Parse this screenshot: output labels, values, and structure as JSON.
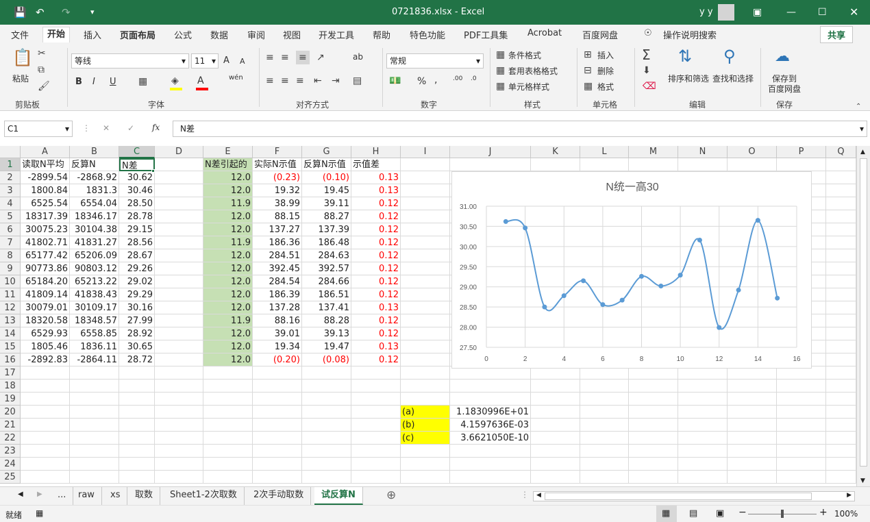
{
  "window": {
    "title": "0721836.xlsx  -  Excel",
    "user": "y y"
  },
  "menu": [
    "文件",
    "开始",
    "插入",
    "页面布局",
    "公式",
    "数据",
    "审阅",
    "视图",
    "开发工具",
    "帮助",
    "特色功能",
    "PDF工具集",
    "Acrobat",
    "百度网盘"
  ],
  "menu_active": "开始",
  "tell_me": "操作说明搜索",
  "share": "共享",
  "ribbon": {
    "clipboard": {
      "label": "剪贴板",
      "paste": "粘贴"
    },
    "font": {
      "label": "字体",
      "name": "等线",
      "size": "11",
      "bold": "B",
      "italic": "I",
      "underline": "U",
      "grow": "A",
      "shrink": "A",
      "phonetic": "wén"
    },
    "alignment": {
      "label": "对齐方式",
      "wrap": "ab"
    },
    "number": {
      "label": "数字",
      "format": "常规",
      "percent": "%",
      "comma": ","
    },
    "styles": {
      "label": "样式",
      "conditional": "条件格式",
      "table": "套用表格格式",
      "cell": "单元格样式"
    },
    "cells": {
      "label": "单元格",
      "insert": "插入",
      "delete": "删除",
      "format": "格式"
    },
    "editing": {
      "label": "编辑",
      "sort": "排序和筛选",
      "find": "查找和选择"
    },
    "save": {
      "label": "保存",
      "btn1": "保存到",
      "btn2": "百度网盘"
    }
  },
  "namebox": "C1",
  "formula": "N差",
  "fx": "fx",
  "columns": [
    "A",
    "B",
    "C",
    "D",
    "E",
    "F",
    "G",
    "H",
    "I",
    "J",
    "K",
    "L",
    "M",
    "N",
    "O",
    "P",
    "Q"
  ],
  "rows": [
    "1",
    "2",
    "3",
    "4",
    "5",
    "6",
    "7",
    "8",
    "9",
    "10",
    "11",
    "12",
    "13",
    "14",
    "15",
    "16",
    "17",
    "18",
    "19",
    "20",
    "21",
    "22",
    "23",
    "24",
    "25"
  ],
  "headers": [
    "读取N平均",
    "反算N",
    "N差",
    "",
    "N差引起的",
    "实际N示值",
    "反算N示值",
    "示值差"
  ],
  "colA": [
    "-2899.54",
    "1800.84",
    "6525.54",
    "18317.39",
    "30075.23",
    "41802.71",
    "65177.42",
    "90773.86",
    "65184.20",
    "41809.14",
    "30079.01",
    "18320.58",
    "6529.93",
    "1805.46",
    "-2892.83"
  ],
  "colB": [
    "-2868.92",
    "1831.3",
    "6554.04",
    "18346.17",
    "30104.38",
    "41831.27",
    "65206.09",
    "90803.12",
    "65213.22",
    "41838.43",
    "30109.17",
    "18348.57",
    "6558.85",
    "1836.11",
    "-2864.11"
  ],
  "colC": [
    "30.62",
    "30.46",
    "28.50",
    "28.78",
    "29.15",
    "28.56",
    "28.67",
    "29.26",
    "29.02",
    "29.29",
    "30.16",
    "27.99",
    "28.92",
    "30.65",
    "28.72"
  ],
  "colE": [
    "12.0",
    "12.0",
    "11.9",
    "12.0",
    "12.0",
    "11.9",
    "12.0",
    "12.0",
    "12.0",
    "12.0",
    "12.0",
    "11.9",
    "12.0",
    "12.0",
    "12.0"
  ],
  "colF": [
    "(0.23)",
    "19.32",
    "38.99",
    "88.15",
    "137.27",
    "186.36",
    "284.51",
    "392.45",
    "284.54",
    "186.39",
    "137.28",
    "88.16",
    "39.01",
    "19.34",
    "(0.20)"
  ],
  "colG": [
    "(0.10)",
    "19.45",
    "39.11",
    "88.27",
    "137.39",
    "186.48",
    "284.63",
    "392.57",
    "284.66",
    "186.51",
    "137.41",
    "88.28",
    "39.13",
    "19.47",
    "(0.08)"
  ],
  "colH": [
    "0.13",
    "0.13",
    "0.12",
    "0.12",
    "0.12",
    "0.12",
    "0.12",
    "0.12",
    "0.12",
    "0.12",
    "0.13",
    "0.12",
    "0.12",
    "0.13",
    "0.12"
  ],
  "coef_labels": [
    "(a)",
    "(b)",
    "(c)"
  ],
  "coef_values": [
    "1.1830996E+01",
    "4.1597636E-03",
    "3.6621050E-10"
  ],
  "colors": {
    "green_fill": "#c6e0b4",
    "yellow_fill": "#ffff00",
    "red_text": "#ff0000",
    "series": "#5b9bd5",
    "excel_green": "#217346"
  },
  "sheet_tabs": [
    "...",
    "raw",
    "xs",
    "取数",
    "Sheet1-2次取数",
    "2次手动取数",
    "试反算N"
  ],
  "active_sheet": "试反算N",
  "status": {
    "ready": "就绪",
    "zoom": "100%"
  },
  "chart_data": {
    "type": "line",
    "title": "N统一高30",
    "smooth": true,
    "x": [
      1,
      2,
      3,
      4,
      5,
      6,
      7,
      8,
      9,
      10,
      11,
      12,
      13,
      14,
      15
    ],
    "series": [
      {
        "values": [
          30.62,
          30.46,
          28.5,
          28.78,
          29.15,
          28.56,
          28.67,
          29.26,
          29.02,
          29.29,
          30.16,
          27.99,
          28.92,
          30.65,
          28.72
        ]
      }
    ],
    "xlim": [
      0,
      16
    ],
    "xticks": [
      "0",
      "2",
      "4",
      "6",
      "8",
      "10",
      "12",
      "14",
      "16"
    ],
    "ylim": [
      27.5,
      31.0
    ],
    "yticks": [
      "31.00",
      "30.50",
      "30.00",
      "29.50",
      "29.00",
      "28.50",
      "28.00",
      "27.50"
    ],
    "grid": true,
    "legend": "none"
  }
}
